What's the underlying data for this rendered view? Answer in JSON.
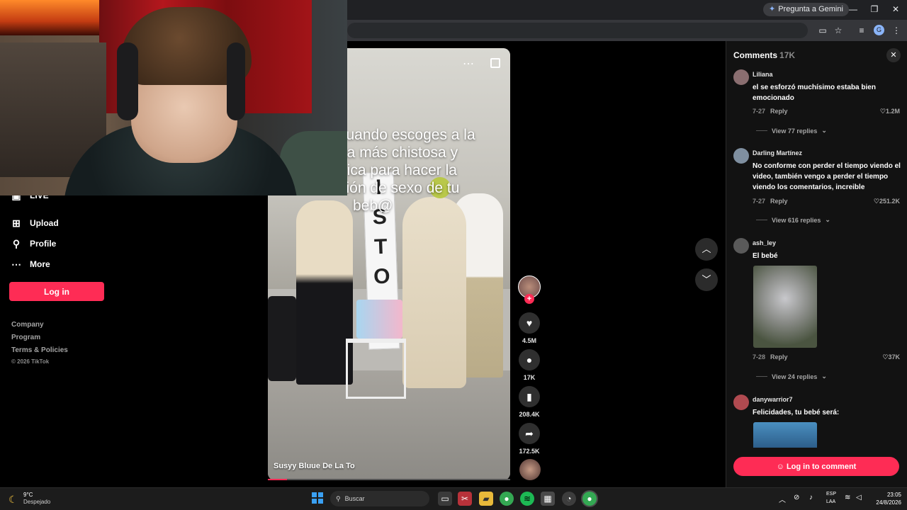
{
  "browser": {
    "gemini_button": "Pregunta a Gemini",
    "profile_initial": "G",
    "minimize": "—",
    "restore": "❐",
    "close": "✕"
  },
  "sidebar": {
    "live_label": "LIVE",
    "items": [
      {
        "label": "Upload",
        "icon": "upload-icon"
      },
      {
        "label": "Profile",
        "icon": "profile-icon"
      },
      {
        "label": "More",
        "icon": "more-dots-icon"
      }
    ],
    "login_label": "Log in",
    "footer_links": [
      "Company",
      "Program",
      "Terms & Policies"
    ],
    "copyright": "© 2026 TikTok"
  },
  "video": {
    "caption_lines": [
      "cuando escoges a la",
      "na más chistosa y",
      "nica para hacer la",
      "ción de sexo de tu",
      "beb@"
    ],
    "banner_letters": [
      "I",
      "S",
      "T",
      "O"
    ],
    "author": "Susyy Bluue De La To",
    "progress": 0.08
  },
  "actions": {
    "likes": "4.5M",
    "comments": "17K",
    "saves": "208.4K",
    "shares": "172.5K"
  },
  "comments_panel": {
    "title": "Comments",
    "count": "17K",
    "login_to_comment": "Log in to comment",
    "items": [
      {
        "user": "Liliana",
        "text": "el se esforzó muchísimo estaba bien emocionado",
        "date": "7-27",
        "reply": "Reply",
        "likes": "1.2M",
        "view_replies": "View 77 replies",
        "avatar_color": "#8a6e70"
      },
      {
        "user": "Darling Martínez",
        "text": "No conforme con perder el tiempo viendo el video, también vengo a perder el tiempo viendo los comentarios, increible",
        "date": "7-27",
        "reply": "Reply",
        "likes": "251.2K",
        "view_replies": "View 616 replies",
        "avatar_color": "#7f8fa0"
      },
      {
        "user": "ash_ley",
        "text": "El bebé",
        "date": "7-28",
        "reply": "Reply",
        "likes": "37K",
        "view_replies": "View 24 replies",
        "avatar_color": "#5a5a5a"
      },
      {
        "user": "danywarrior7",
        "text": "Felicidades, tu bebé será:",
        "avatar_color": "#b04a50"
      }
    ]
  },
  "taskbar": {
    "temperature": "9°C",
    "weather": "Despejado",
    "search_placeholder": "Buscar",
    "lang_line1": "ESP",
    "lang_line2": "LAA",
    "time": "23:05",
    "date": "24/8/2026"
  },
  "colors": {
    "accent": "#fe2c55",
    "panel": "#121212"
  }
}
